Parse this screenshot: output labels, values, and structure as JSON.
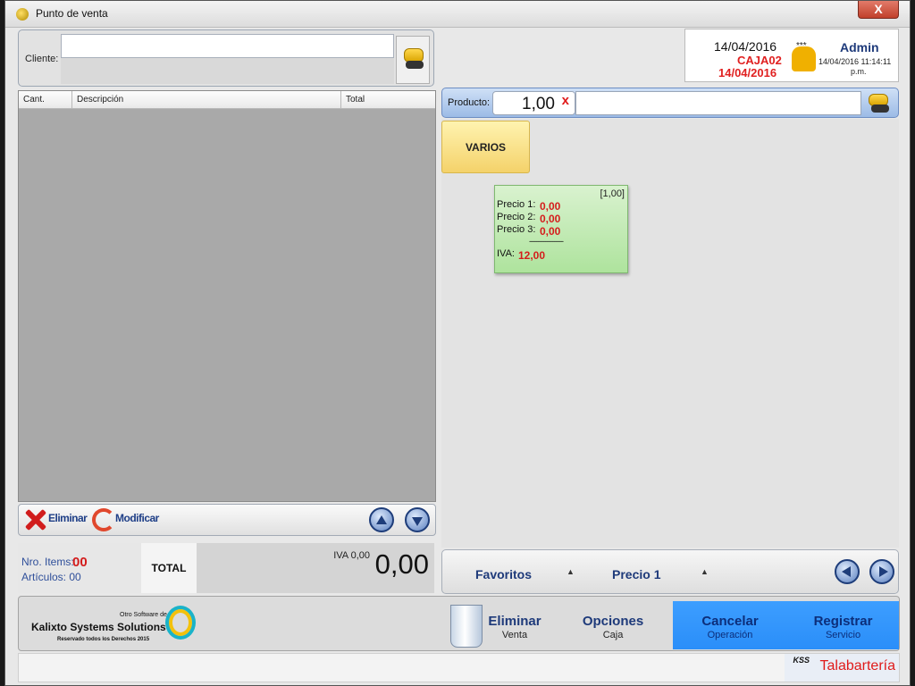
{
  "window": {
    "title": "Punto de venta",
    "close_label": "X"
  },
  "client": {
    "label": "Cliente:",
    "value": ""
  },
  "list": {
    "columns": [
      "Cant.",
      "Descripción",
      "Total"
    ],
    "rows": []
  },
  "list_actions": {
    "delete_label": "Eliminar",
    "modify_label": "Modificar"
  },
  "totals": {
    "items_label": "Nro. Items:",
    "items_value": "00",
    "articles_label": "Artículos: 00",
    "total_label": "TOTAL",
    "iva_label": "IVA 0,00",
    "amount": "0,00"
  },
  "user": {
    "date": "14/04/2016",
    "caja": "CAJA02",
    "date_red": "14/04/2016",
    "stars": "***",
    "name": "Admin",
    "datetime": "14/04/2016 11:14:11",
    "ampm": "p.m."
  },
  "product": {
    "label": "Producto:",
    "quantity": "1,00",
    "quantity_x": "x",
    "value": ""
  },
  "category": {
    "label": "VARIOS"
  },
  "price_card": {
    "qty": "[1,00]",
    "precio1_label": "Precio 1:",
    "precio1": "0,00",
    "precio2_label": "Precio 2:",
    "precio2": "0,00",
    "precio3_label": "Precio 3:",
    "precio3": "0,00",
    "separator": "-------------------",
    "iva_label": "IVA:",
    "iva": "12,00"
  },
  "fav_bar": {
    "favoritos": "Favoritos",
    "precio": "Precio 1",
    "caret": "▲"
  },
  "footer": {
    "brand_small": "Otro Software de",
    "brand_name": "Kalixto Systems Solutions",
    "brand_rights": "Reservado todos los Derechos 2015",
    "eliminar": "Eliminar",
    "eliminar_sub": "Venta",
    "opciones": "Opciones",
    "opciones_sub": "Caja",
    "cancelar": "Cancelar",
    "cancelar_sub": "Operación",
    "registrar": "Registrar",
    "registrar_sub": "Servicio"
  },
  "status": {
    "kss": "KSS",
    "business": "Talabartería"
  },
  "colors": {
    "accent_red": "#e01a1a",
    "accent_blue": "#1e3a7a",
    "button_blue": "#2a8ef9"
  }
}
